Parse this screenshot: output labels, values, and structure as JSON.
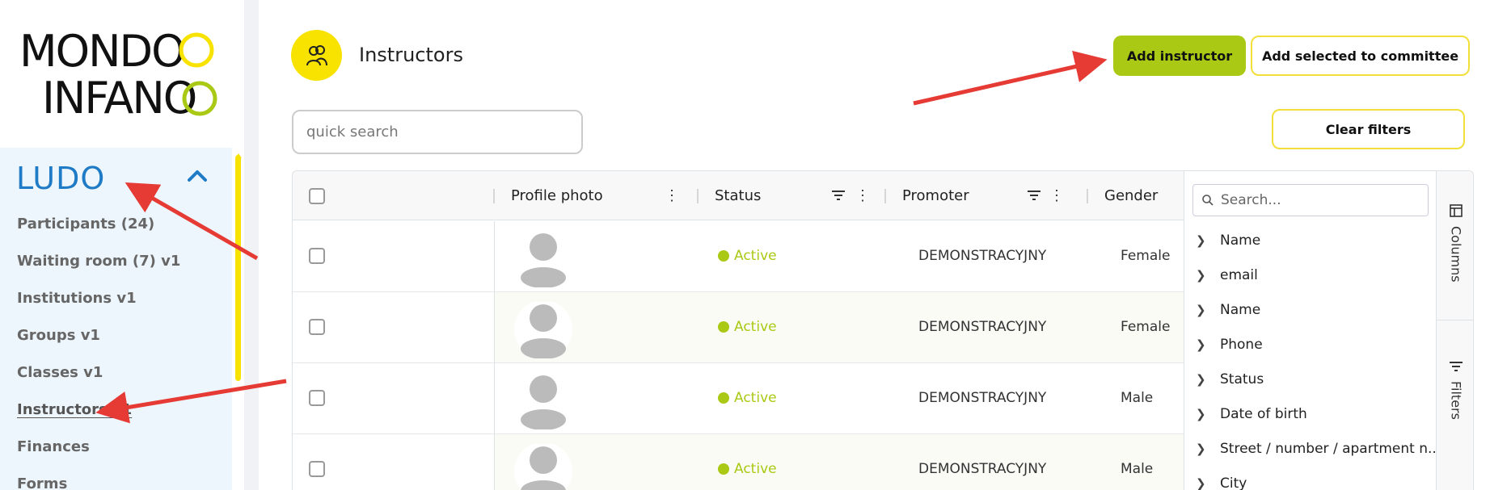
{
  "colors": {
    "accent_green": "#a9c914",
    "accent_yellow": "#f8e300",
    "brand_blue": "#1f7bc6",
    "arrow_red": "#e63a35"
  },
  "logo": {
    "line1": "MONDO",
    "line2": "INFANO"
  },
  "sidebar": {
    "section_title": "LUDO",
    "section_icon": "chevron-up-icon",
    "items": [
      {
        "label": "Participants (24)"
      },
      {
        "label": "Waiting room (7) v1"
      },
      {
        "label": "Institutions v1"
      },
      {
        "label": "Groups v1"
      },
      {
        "label": "Classes v1"
      },
      {
        "label": "Instructors v1",
        "active": true
      },
      {
        "label": "Finances"
      },
      {
        "label": "Forms"
      }
    ]
  },
  "header": {
    "title": "Instructors",
    "icon": "instructors-icon",
    "add_instructor_label": "Add instructor",
    "add_committee_label": "Add selected to committee",
    "clear_filters_label": "Clear filters"
  },
  "search": {
    "placeholder": "quick search"
  },
  "grid": {
    "columns": [
      "Profile photo",
      "Status",
      "Promoter",
      "Gender"
    ],
    "rows": [
      {
        "status": "Active",
        "promoter": "DEMONSTRACYJNY",
        "gender": "Female"
      },
      {
        "status": "Active",
        "promoter": "DEMONSTRACYJNY",
        "gender": "Female"
      },
      {
        "status": "Active",
        "promoter": "DEMONSTRACYJNY",
        "gender": "Male"
      },
      {
        "status": "Active",
        "promoter": "DEMONSTRACYJNY",
        "gender": "Male"
      }
    ]
  },
  "tool_panel": {
    "search_placeholder": "Search...",
    "columns": [
      "Name",
      "email",
      "Name",
      "Phone",
      "Status",
      "Date of birth",
      "Street / number / apartment n...",
      "City"
    ],
    "tabs": {
      "columns": "Columns",
      "filters": "Filters"
    }
  }
}
